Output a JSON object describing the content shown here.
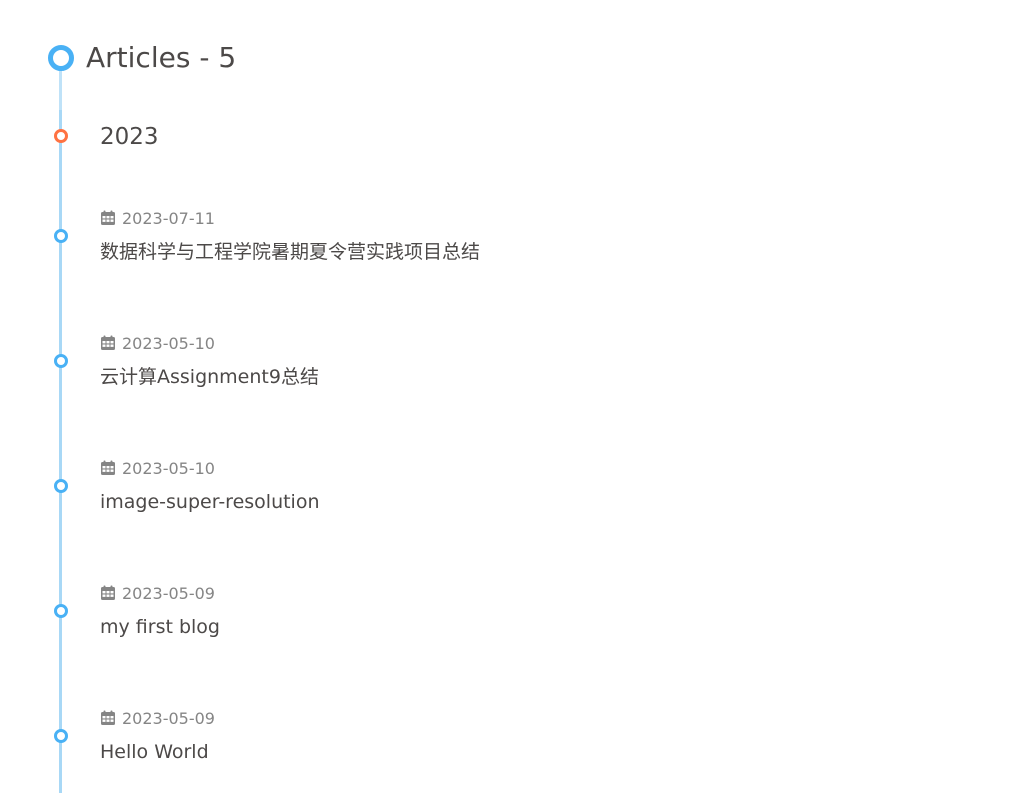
{
  "header": {
    "title": "Articles - 5"
  },
  "year": {
    "label": "2023"
  },
  "articles": [
    {
      "date": "2023-07-11",
      "title": "数据科学与工程学院暑期夏令营实践项目总结"
    },
    {
      "date": "2023-05-10",
      "title": "云计算Assignment9总结"
    },
    {
      "date": "2023-05-10",
      "title": "image-super-resolution"
    },
    {
      "date": "2023-05-09",
      "title": "my first blog"
    },
    {
      "date": "2023-05-09",
      "title": "Hello World"
    }
  ],
  "colors": {
    "accent": "#49b1f5",
    "year_dot": "#ff7242",
    "line": "#a8d8f6",
    "text": "#4c4948",
    "meta": "#858585"
  },
  "icons": {
    "header": "circle-icon",
    "date": "calendar-icon"
  }
}
